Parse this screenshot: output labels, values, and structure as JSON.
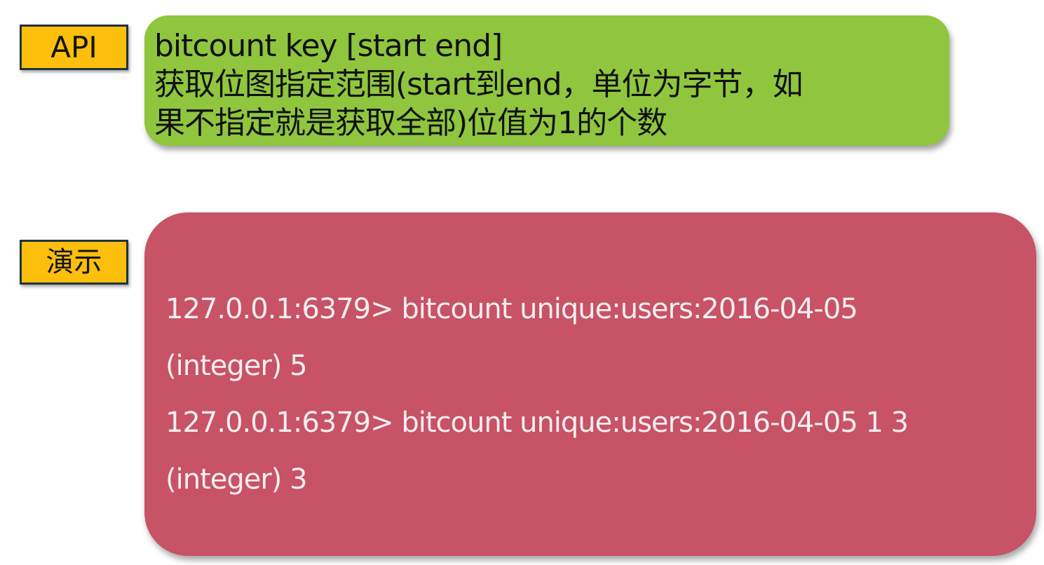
{
  "labels": {
    "api": "API",
    "demo": "演示"
  },
  "api_box": {
    "lines": [
      "bitcount key [start end]",
      "获取位图指定范围(start到end，单位为字节，如",
      "果不指定就是获取全部)位值为1的个数"
    ]
  },
  "demo_box": {
    "lines": [
      "127.0.0.1:6379> bitcount unique:users:2016-04-05",
      "(integer) 5",
      "127.0.0.1:6379> bitcount unique:users:2016-04-05 1 3",
      "(integer) 3"
    ]
  },
  "colors": {
    "tag_background": "#fbbf0c",
    "tag_border": "#1f3340",
    "api_box_background": "#8fc63e",
    "demo_box_background": "#c85266",
    "demo_text": "#f3eef0"
  }
}
